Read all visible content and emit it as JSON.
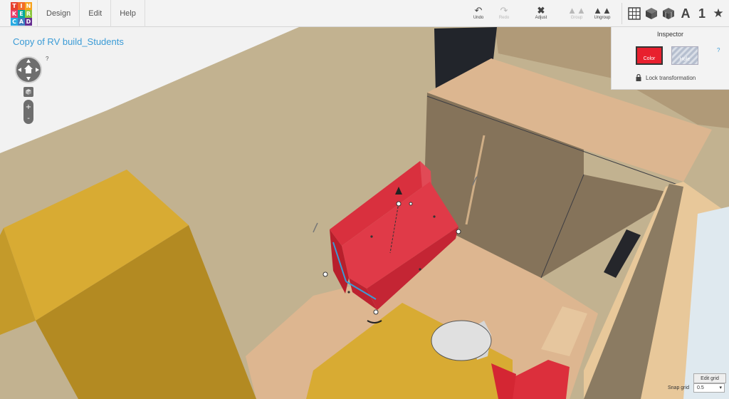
{
  "app": {
    "logo_letters": [
      "T",
      "I",
      "N",
      "K",
      "E",
      "R",
      "C",
      "A",
      "D"
    ],
    "logo_colors": [
      "#e6412f",
      "#f26c2a",
      "#f7a21c",
      "#e83d6b",
      "#00a79d",
      "#8cc63f",
      "#29abe2",
      "#3f7fc1",
      "#662d91"
    ]
  },
  "menu": {
    "design": "Design",
    "edit": "Edit",
    "help": "Help"
  },
  "toolbar": {
    "undo": {
      "label": "Undo",
      "icon": "undo-arrow-icon"
    },
    "redo": {
      "label": "Redo",
      "icon": "redo-arrow-icon",
      "disabled": true
    },
    "adjust": {
      "label": "Adjust",
      "icon": "adjust-tools-icon"
    },
    "group": {
      "label": "Group",
      "icon": "group-mountains-icon",
      "disabled": true
    },
    "ungroup": {
      "label": "Ungroup",
      "icon": "ungroup-mountains-icon"
    }
  },
  "view_tools": {
    "text_label": "A",
    "number_label": "1",
    "icons": [
      "workplane-grid-icon",
      "box-icon",
      "cube-menu-icon",
      "text-icon",
      "number-icon",
      "star-icon"
    ]
  },
  "document": {
    "title": "Copy of RV build_Students",
    "help": "?"
  },
  "inspector": {
    "title": "Inspector",
    "color_label": "Color",
    "hole_label": "Hole",
    "lock_label": "Lock transformation",
    "help": "?",
    "color_value": "#e8202e"
  },
  "grid": {
    "edit_label": "Edit grid",
    "snap_label": "Snap grid",
    "snap_value": "0.5"
  },
  "colors": {
    "accent": "#3a9bd6",
    "couch": "#de3140",
    "mustard": "#d6a735"
  }
}
